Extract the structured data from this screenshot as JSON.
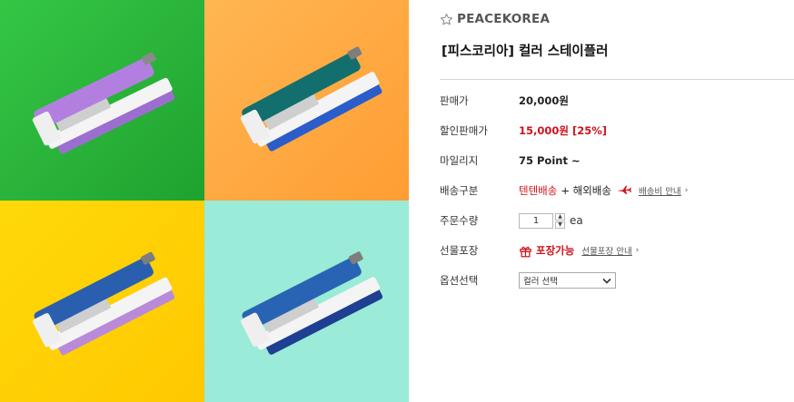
{
  "brand": "PEACEKOREA",
  "product_title": "[피스코리아] 컬러 스테이플러",
  "rows": {
    "price": {
      "label": "판매가",
      "value": "20,000원"
    },
    "sale": {
      "label": "할인판매가",
      "value": "15,000원 [25%]"
    },
    "mileage": {
      "label": "마일리지",
      "value": "75 Point ~"
    },
    "shipping": {
      "label": "배송구분",
      "value_red": "텐텐배송",
      "value_plus": "+ 해외배송",
      "link": "배송비 안내"
    },
    "quantity": {
      "label": "주문수량",
      "value": "1",
      "unit": "ea",
      "up": "▲",
      "down": "▼"
    },
    "gift": {
      "label": "선물포장",
      "value": "포장가능",
      "link": "선물포장 안내"
    },
    "option": {
      "label": "옵션선택",
      "selected": "컬러 선택",
      "arrow": "⌄"
    }
  },
  "caret": "›",
  "colors": {
    "sale_red": "#d0121b",
    "tile_green": "#2fb53c",
    "tile_orange": "#ffaa45",
    "tile_yellow": "#ffd100",
    "tile_mint": "#98ebd6"
  },
  "icons": [
    "star-icon",
    "airplane-icon",
    "gift-icon",
    "chevron-right-icon",
    "chevron-down-icon"
  ]
}
